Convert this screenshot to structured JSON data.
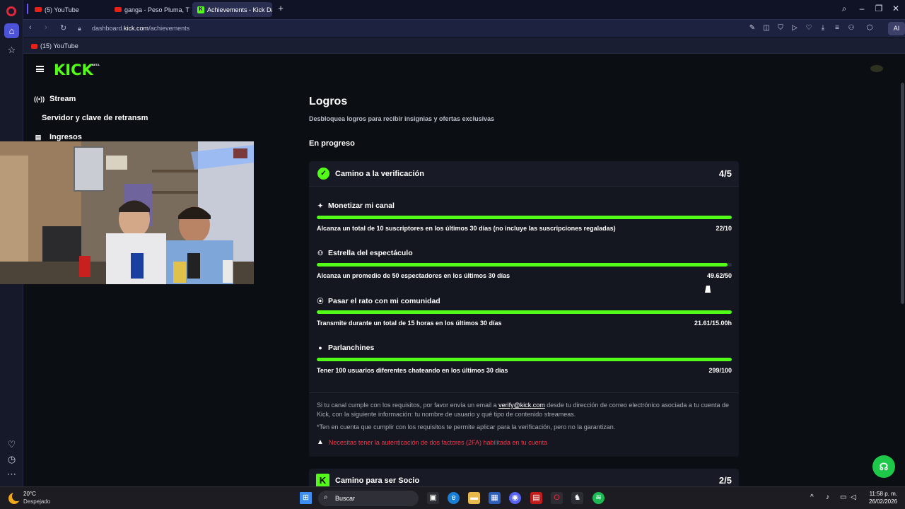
{
  "browser": {
    "tabs": [
      {
        "label": "(5) YouTube",
        "icon": "youtube-icon"
      },
      {
        "label": "ganga - Peso Pluma, Tito",
        "icon": "youtube-icon"
      },
      {
        "label": "Achievements - Kick Dash",
        "icon": "kick-icon",
        "active": true
      }
    ],
    "url_prefix": "dashboard.",
    "url_domain": "kick.com",
    "url_path": "/achievements",
    "ai_label": "AI",
    "bookmarks": [
      {
        "label": "(15) YouTube"
      }
    ]
  },
  "kick": {
    "logo": "KICK",
    "beta": "BETA",
    "sidebar": [
      {
        "label": "Stream",
        "icon": "stream-icon"
      },
      {
        "label": "Servidor y clave de retransm",
        "icon": ""
      },
      {
        "label": "Ingresos",
        "icon": "chart-icon"
      }
    ]
  },
  "main": {
    "title": "Logros",
    "subtitle": "Desbloquea logros para recibir insignias y ofertas exclusivas",
    "section": "En progreso",
    "card1": {
      "title": "Camino a la verificación",
      "count": "4/5",
      "achievements": [
        {
          "name": "Monetizar mi canal",
          "icon": "sparkle-icon",
          "desc": "Alcanza un total de 10 suscriptores en los últimos 30 días (no incluye las suscripciones regaladas)",
          "value": "22/10",
          "progress": 1.0
        },
        {
          "name": "Estrella del espectáculo",
          "icon": "users-icon",
          "desc": "Alcanza un promedio de 50 espectadores en los últimos 30 días",
          "value": "49.62/50",
          "progress": 0.99
        },
        {
          "name": "Pasar el rato con mi comunidad",
          "icon": "broadcast-icon",
          "desc": "Transmite durante un total de 15 horas en los últimos 30 días",
          "value": "21.61/15.00h",
          "progress": 1.0
        },
        {
          "name": "Parlanchines",
          "icon": "chat-icon",
          "desc": "Tener 100 usuarios diferentes chateando en los últimos 30 días",
          "value": "299/100",
          "progress": 1.0
        }
      ],
      "info_pre": "Si tu canal cumple con los requisitos, por favor envía un email a ",
      "info_email": "verify@kick.com",
      "info_post": " desde tu dirección de correo electrónico asociada a tu cuenta de Kick, con la siguiente información: tu nombre de usuario y qué tipo de contenido streameas.",
      "note": "*Ten en cuenta que cumplir con los requisitos te permite aplicar para la verificación, pero no la garantizan.",
      "warning": "Necesitas tener la autenticación de dos factores (2FA) habilitada en tu cuenta"
    },
    "card2": {
      "title": "Camino para ser Socio",
      "count": "2/5"
    }
  },
  "taskbar": {
    "temp": "20°C",
    "condition": "Despejado",
    "search": "Buscar",
    "time": "11:58 p. m.",
    "date": "26/02/2026"
  },
  "colors": {
    "kick_green": "#53fc18",
    "warning_red": "#f0384a",
    "background": "#0b0e13"
  }
}
